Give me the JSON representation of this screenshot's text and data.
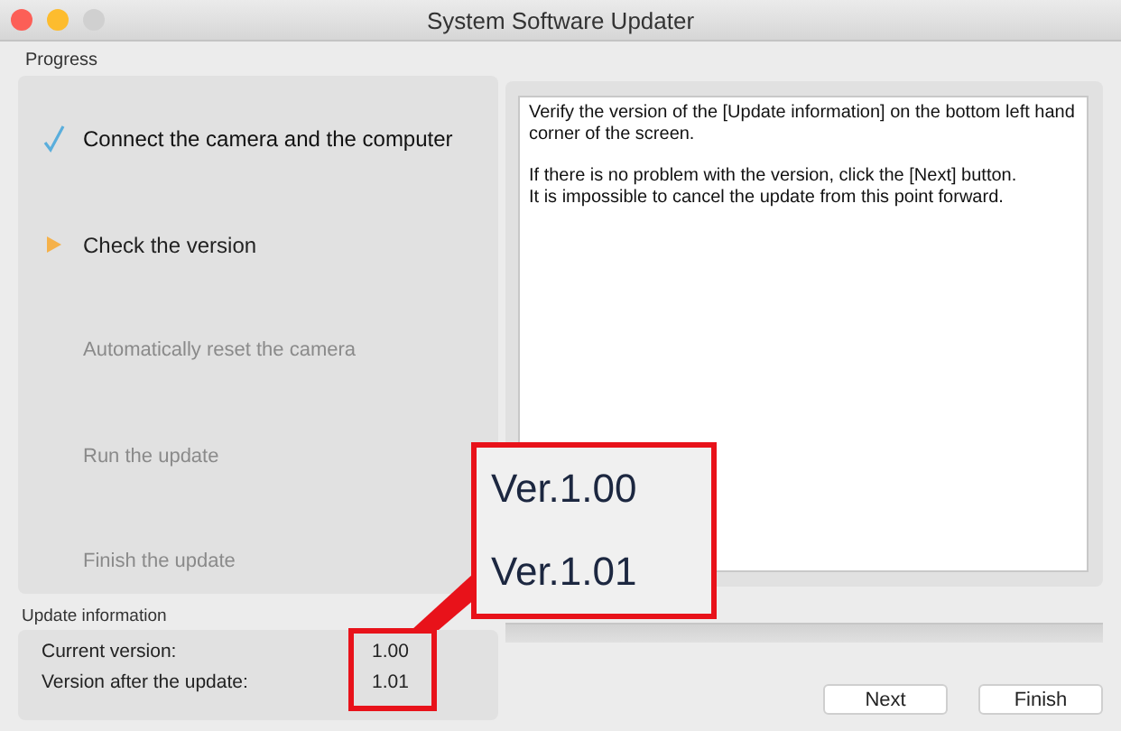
{
  "window": {
    "title": "System Software Updater"
  },
  "progress_section": {
    "label": "Progress",
    "steps": [
      {
        "label": "Connect the camera and the computer",
        "kind": "done"
      },
      {
        "label": "Check the version",
        "kind": "current"
      },
      {
        "label": "Automatically reset the camera",
        "kind": "pending"
      },
      {
        "label": "Run the update",
        "kind": "pending"
      },
      {
        "label": "Finish the update",
        "kind": "pending"
      }
    ]
  },
  "update_information": {
    "label": "Update information",
    "rows": [
      {
        "label": "Current version:",
        "value": "1.00"
      },
      {
        "label": "Version after the update:",
        "value": "1.01"
      }
    ]
  },
  "message": {
    "paragraphs": [
      "Verify the version of the [Update information] on the bottom left hand corner of the screen.",
      "If there is no problem with the version, click the [Next] button.\nIt is impossible to cancel the update from this point forward."
    ]
  },
  "progress_bar": {
    "level": 0
  },
  "buttons": [
    {
      "label": "Next"
    },
    {
      "label": "Finish"
    }
  ],
  "callout": {
    "lines": [
      "Ver.1.00",
      "Ver.1.01"
    ]
  }
}
